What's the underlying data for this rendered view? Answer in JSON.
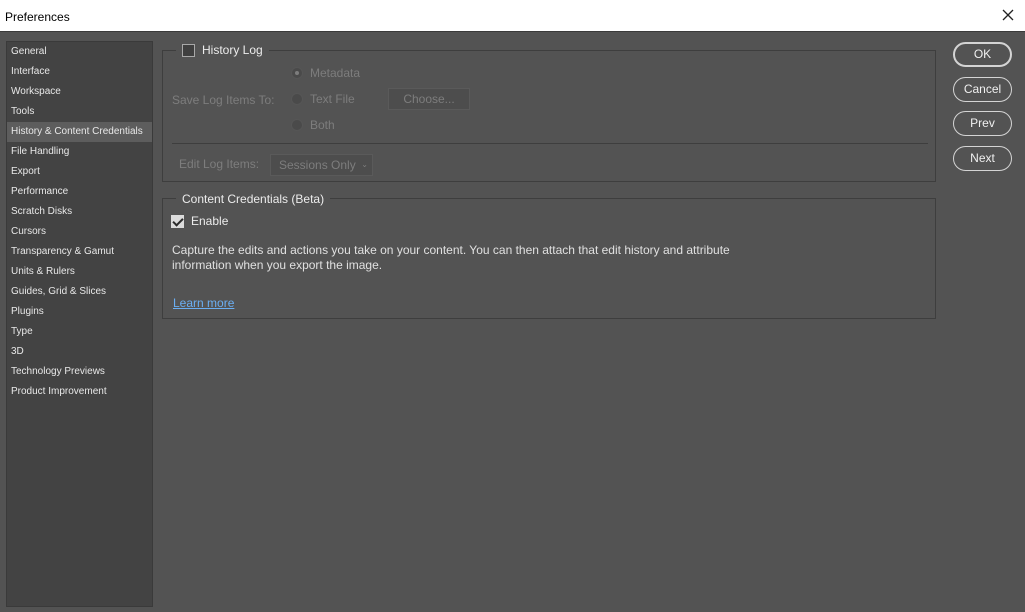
{
  "window": {
    "title": "Preferences"
  },
  "sidebar": {
    "items": [
      {
        "label": "General"
      },
      {
        "label": "Interface"
      },
      {
        "label": "Workspace"
      },
      {
        "label": "Tools"
      },
      {
        "label": "History & Content Credentials",
        "selected": true
      },
      {
        "label": "File Handling"
      },
      {
        "label": "Export"
      },
      {
        "label": "Performance"
      },
      {
        "label": "Scratch Disks"
      },
      {
        "label": "Cursors"
      },
      {
        "label": "Transparency & Gamut"
      },
      {
        "label": "Units & Rulers"
      },
      {
        "label": "Guides, Grid & Slices"
      },
      {
        "label": "Plugins"
      },
      {
        "label": "Type"
      },
      {
        "label": "3D"
      },
      {
        "label": "Technology Previews"
      },
      {
        "label": "Product Improvement"
      }
    ]
  },
  "history_log": {
    "label": "History Log",
    "checked": false,
    "save_label": "Save Log Items To:",
    "options": [
      "Metadata",
      "Text File",
      "Both"
    ],
    "selected_option": "Metadata",
    "choose_label": "Choose...",
    "edit_label": "Edit Log Items:",
    "edit_value": "Sessions Only"
  },
  "content_credentials": {
    "title": "Content Credentials (Beta)",
    "enable_label": "Enable",
    "enabled": true,
    "description_line1": "Capture the edits and actions you take on your content. You can then attach that edit history and attribute",
    "description_line2": "information when you export the image.",
    "learn_more": "Learn more"
  },
  "buttons": {
    "ok": "OK",
    "cancel": "Cancel",
    "prev": "Prev",
    "next": "Next"
  },
  "colors": {
    "background": "#535353",
    "sidebar": "#434343",
    "link": "#6aaef2",
    "selected": "#5d5d5d"
  }
}
